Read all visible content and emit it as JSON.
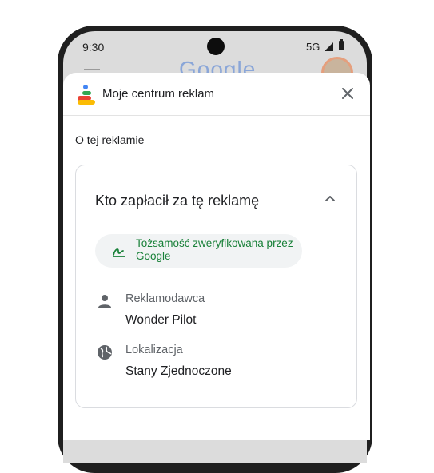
{
  "status_bar": {
    "time": "9:30",
    "network": "5G"
  },
  "background_app": {
    "logo": "Google",
    "menu_icon": "menu-icon",
    "avatar": "avatar"
  },
  "sheet": {
    "title": "Moje centrum reklam",
    "close_icon": "close-icon",
    "section_label": "O tej reklamie"
  },
  "card": {
    "title": "Kto zapłacił za tę reklamę",
    "expand_icon": "chevron-up-icon",
    "verified_text": "Tożsamość zweryfikowana przez Google",
    "advertiser_label": "Reklamodawca",
    "advertiser_value": "Wonder Pilot",
    "location_label": "Lokalizacja",
    "location_value": "Stany Zjednoczone"
  },
  "colors": {
    "accent_green": "#188038",
    "chip_bg": "#f1f3f4",
    "border": "#dadce0",
    "muted_text": "#5f6368"
  }
}
